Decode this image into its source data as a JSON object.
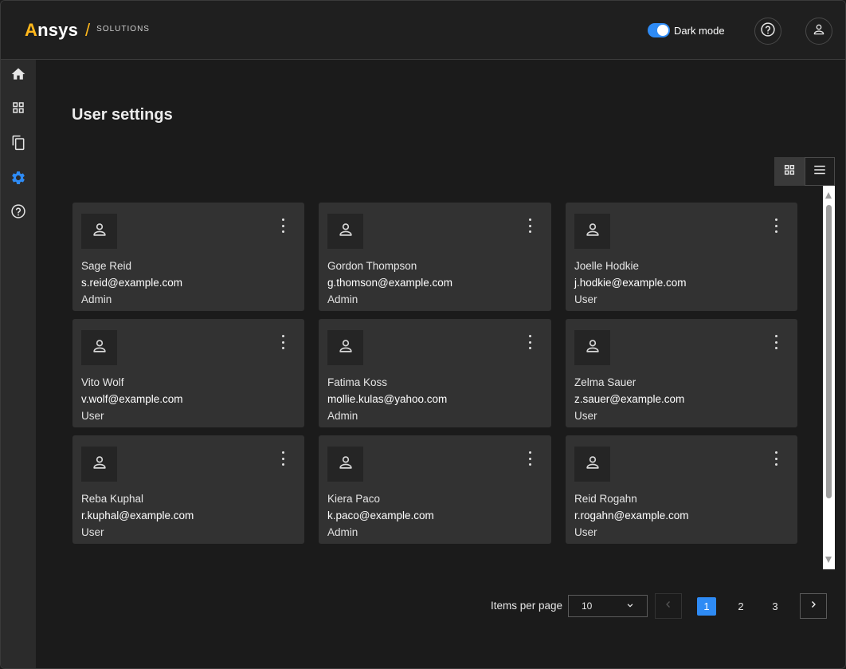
{
  "header": {
    "brand": "Ansys",
    "brand_sub": "SOLUTIONS",
    "dark_mode_label": "Dark mode",
    "dark_mode_on": true,
    "help_icon": "help-circle-icon",
    "user_icon": "person-icon"
  },
  "sidebar": {
    "items": [
      {
        "icon": "home-icon",
        "active": false
      },
      {
        "icon": "dashboard-icon",
        "active": false
      },
      {
        "icon": "copy-icon",
        "active": false
      },
      {
        "icon": "settings-icon",
        "active": true
      },
      {
        "icon": "help-circle-icon",
        "active": false
      }
    ]
  },
  "colors": {
    "accent": "#2e8bf5",
    "brand_gold": "#ffb71b",
    "card_bg": "#323232",
    "page_bg": "#1b1b1b"
  },
  "main": {
    "title": "User settings",
    "view_modes": [
      "grid",
      "list"
    ],
    "active_view": "grid"
  },
  "users": [
    {
      "name": "Sage Reid",
      "email": "s.reid@example.com",
      "role": "Admin"
    },
    {
      "name": "Gordon Thompson",
      "email": "g.thomson@example.com",
      "role": "Admin"
    },
    {
      "name": "Joelle Hodkie",
      "email": "j.hodkie@example.com",
      "role": "User"
    },
    {
      "name": "Vito Wolf",
      "email": "v.wolf@example.com",
      "role": "User"
    },
    {
      "name": "Fatima Koss",
      "email": "mollie.kulas@yahoo.com",
      "role": "Admin"
    },
    {
      "name": "Zelma Sauer",
      "email": "z.sauer@example.com",
      "role": "User"
    },
    {
      "name": "Reba Kuphal",
      "email": "r.kuphal@example.com",
      "role": "User"
    },
    {
      "name": "Kiera Paco",
      "email": "k.paco@example.com",
      "role": "Admin"
    },
    {
      "name": "Reid Rogahn",
      "email": "r.rogahn@example.com",
      "role": "User"
    }
  ],
  "pagination": {
    "items_per_page_label": "Items per page",
    "items_per_page_value": "10",
    "pages": [
      "1",
      "2",
      "3"
    ],
    "current_page": "1"
  }
}
